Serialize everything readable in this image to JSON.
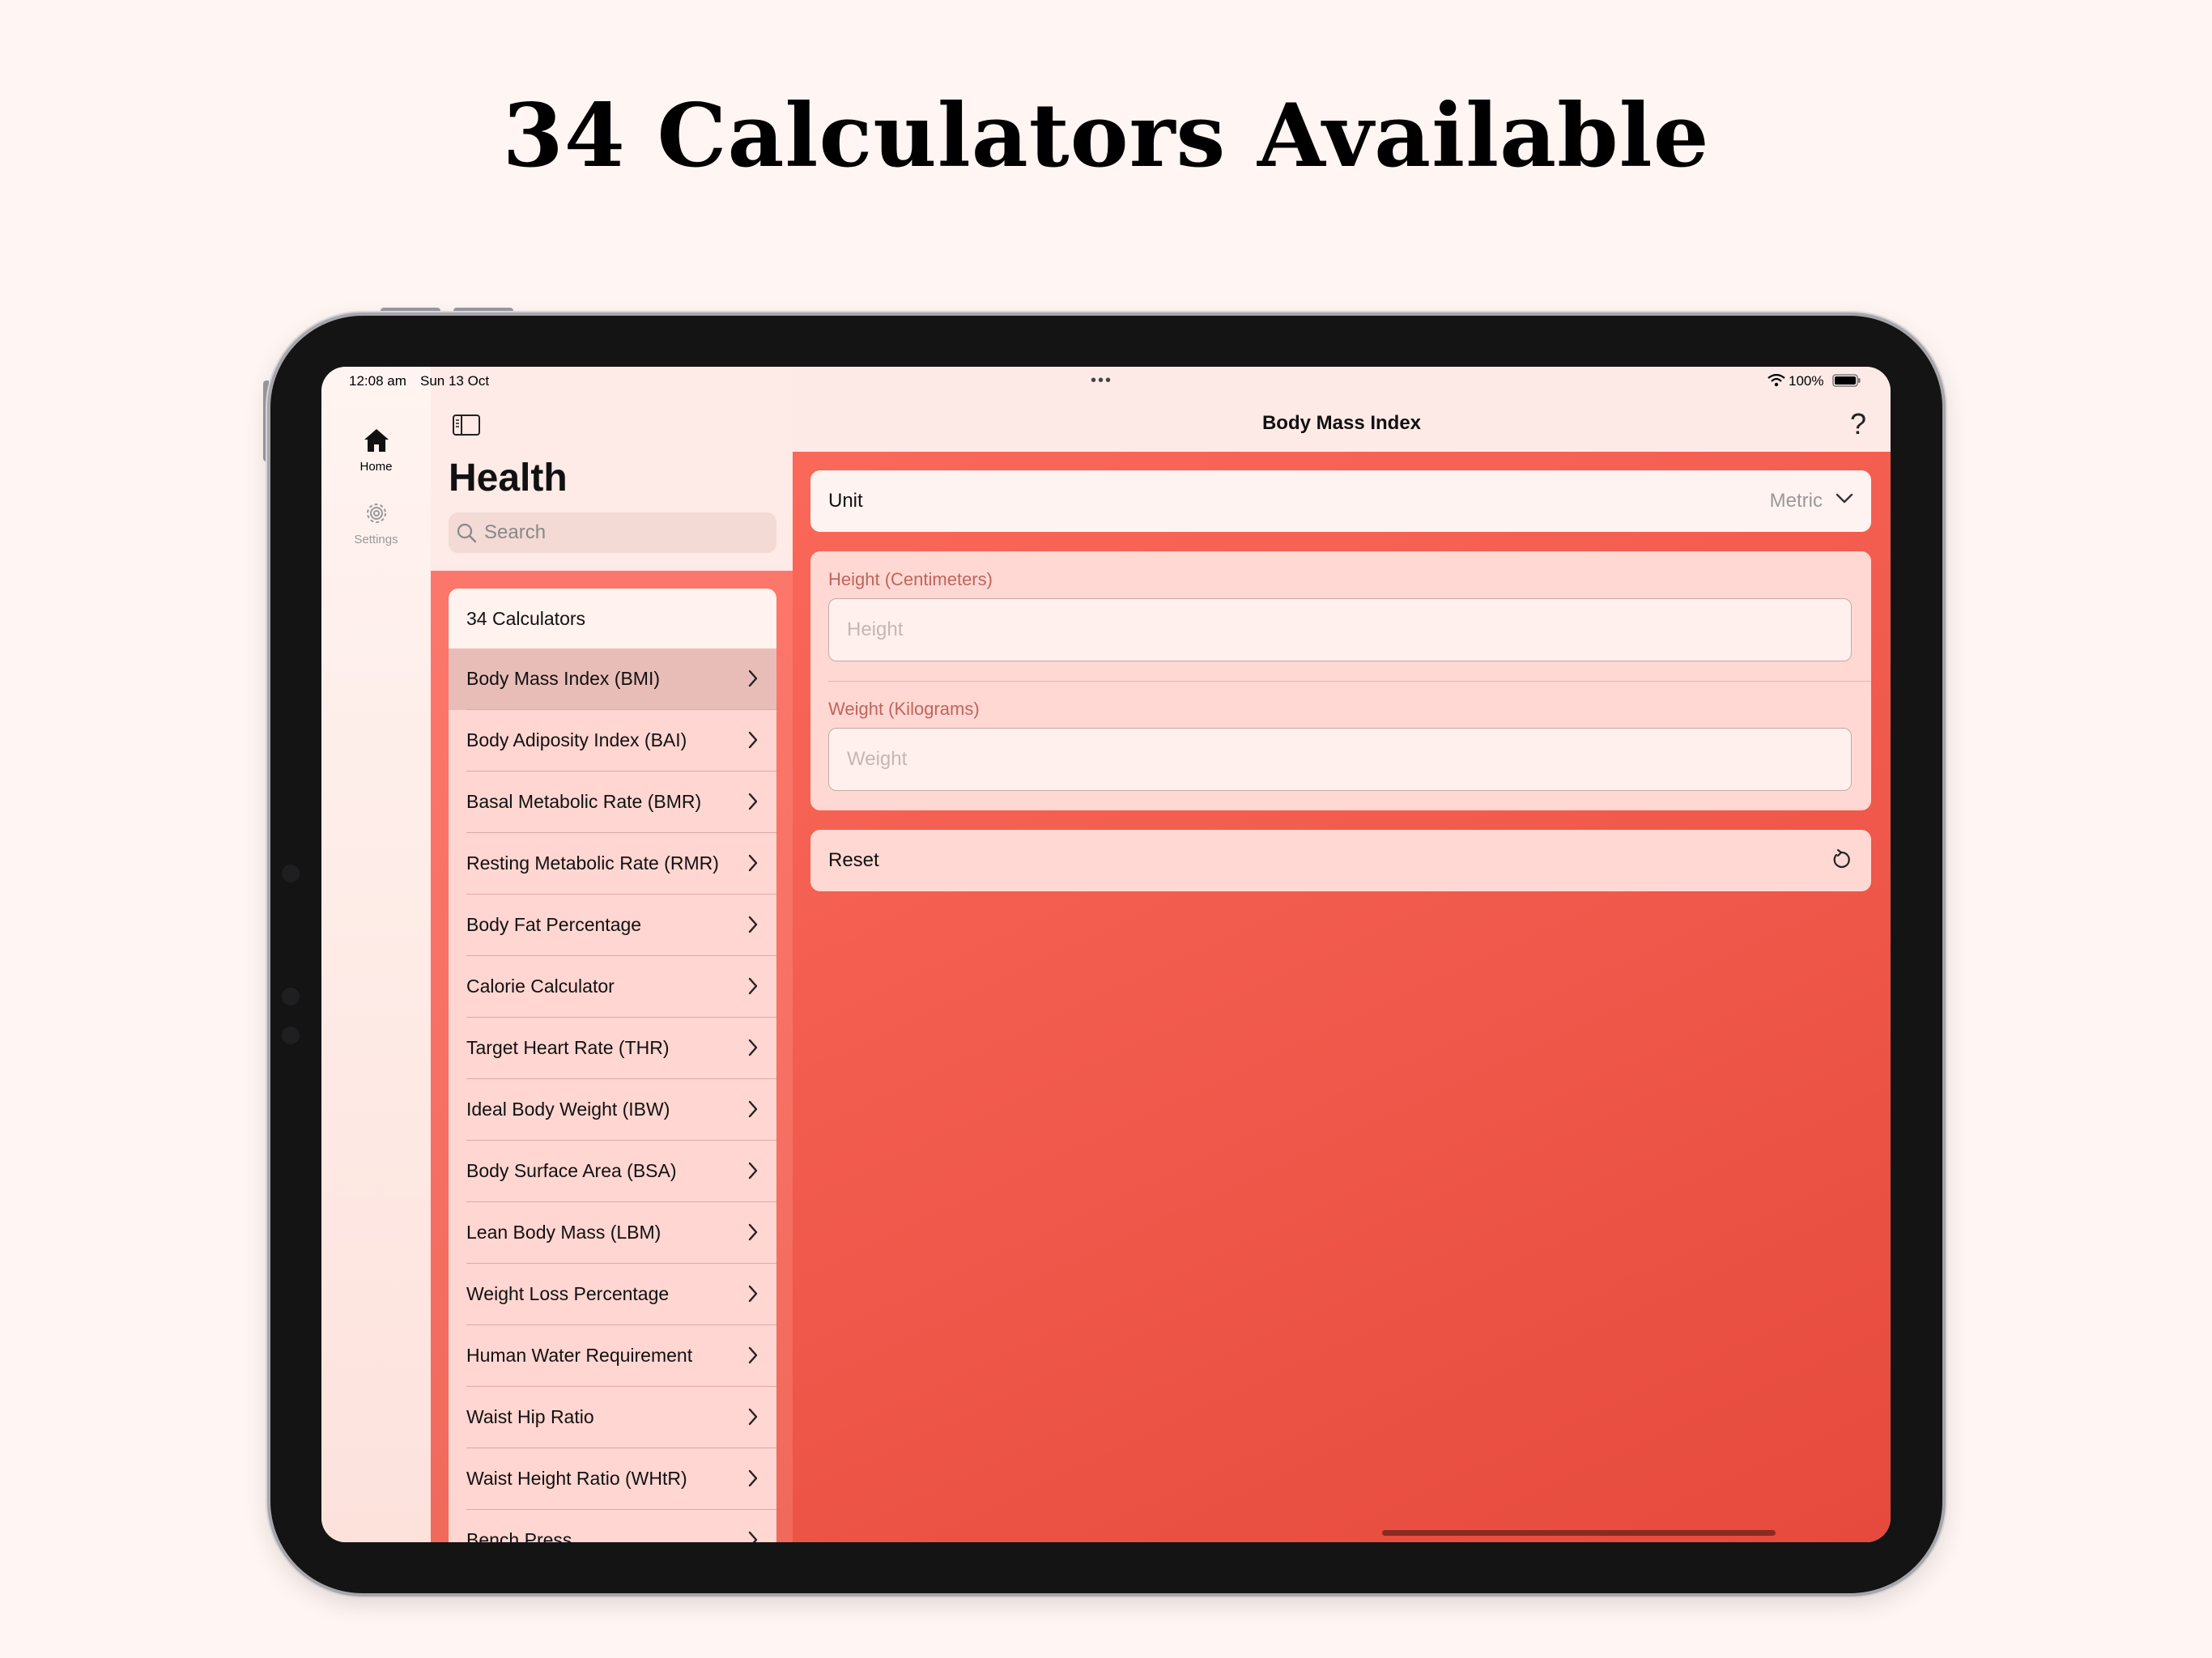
{
  "headline": "34 Calculators Available",
  "status_bar": {
    "time": "12:08 am",
    "date": "Sun 13 Oct",
    "battery": "100%"
  },
  "rail": {
    "items": [
      {
        "label": "Home",
        "icon": "house-icon",
        "selected": true
      },
      {
        "label": "Settings",
        "icon": "gear-icon",
        "selected": false
      }
    ]
  },
  "sidebar": {
    "title": "Health",
    "search_placeholder": "Search",
    "list_header": "34 Calculators",
    "items": [
      "Body Mass Index (BMI)",
      "Body Adiposity Index (BAI)",
      "Basal Metabolic Rate (BMR)",
      "Resting Metabolic Rate (RMR)",
      "Body Fat Percentage",
      "Calorie Calculator",
      "Target Heart Rate (THR)",
      "Ideal Body Weight (IBW)",
      "Body Surface Area (BSA)",
      "Lean Body Mass (LBM)",
      "Weight Loss Percentage",
      "Human Water Requirement",
      "Waist Hip Ratio",
      "Waist Height Ratio (WHtR)",
      "Bench Press"
    ],
    "selected_index": 0
  },
  "detail": {
    "title": "Body Mass Index",
    "help": "?",
    "unit": {
      "label": "Unit",
      "value": "Metric"
    },
    "height": {
      "label": "Height (Centimeters)",
      "placeholder": "Height"
    },
    "weight": {
      "label": "Weight (Kilograms)",
      "placeholder": "Weight"
    },
    "reset_label": "Reset"
  },
  "colors": {
    "accent": "#f0604f",
    "selected_row": "#e8bdb8",
    "row_bg": "#ffd6d1",
    "page_bg": "#fff5f2"
  }
}
